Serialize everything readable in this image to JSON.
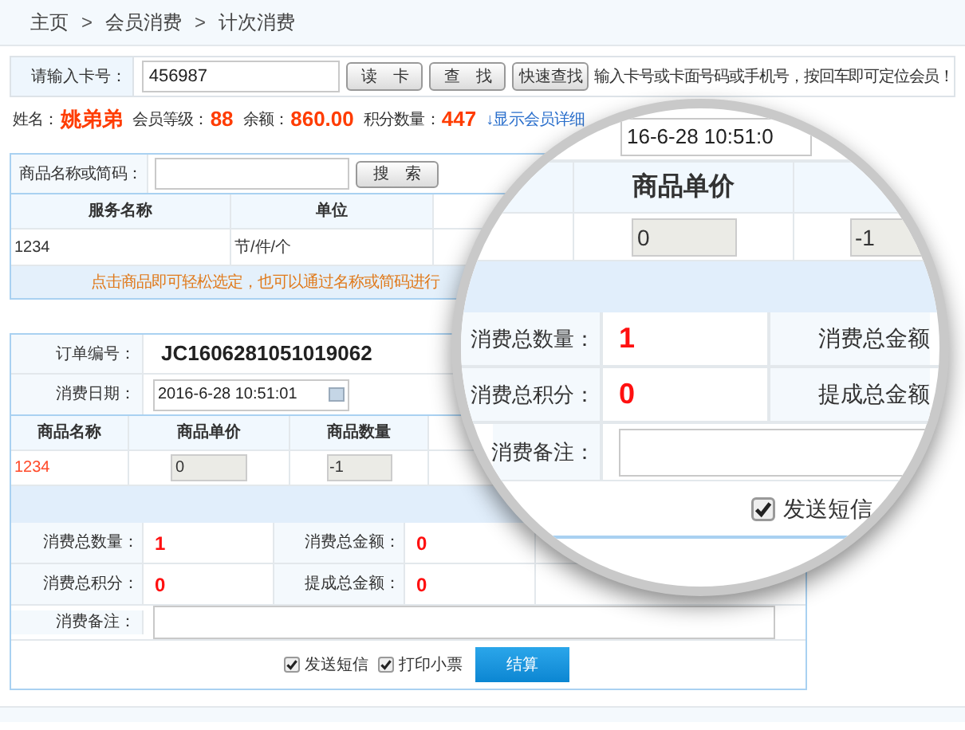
{
  "breadcrumb": {
    "items": [
      "主页",
      "会员消费",
      "计次消费"
    ],
    "separator": ">"
  },
  "card_lookup": {
    "label": "请输入卡号：",
    "value": "456987",
    "buttons": [
      "读　卡",
      "查　找",
      "快速查找"
    ],
    "hint": "输入卡号或卡面号码或手机号，按回车即可定位会员！"
  },
  "member": [
    {
      "label": "姓名：",
      "value": "姚弟弟"
    },
    {
      "label": "会员等级：",
      "value": "88"
    },
    {
      "label": "余额：",
      "value": "860.00"
    },
    {
      "label": "积分数量：",
      "value": "447"
    }
  ],
  "member_link": "↓显示会员详细",
  "product_search": {
    "label": "商品名称或简码：",
    "button": "搜　索",
    "columns": [
      "服务名称",
      "单位"
    ],
    "rows": [
      [
        "1234",
        "节/件/个"
      ]
    ],
    "tip": "点击商品即可轻松选定，也可以通过名称或简码进行"
  },
  "order": {
    "number_label": "订单编号：",
    "number": "JC1606281051019062",
    "date_label": "消费日期：",
    "date": "2016-6-28 10:51:01",
    "columns": [
      "商品名称",
      "商品单价",
      "商品数量"
    ],
    "items": [
      {
        "name": "1234",
        "price": "0",
        "quantity": "-1"
      }
    ],
    "totals": [
      {
        "label": "消费总数量：",
        "value": "1"
      },
      {
        "label": "消费总金额：",
        "value": "0"
      },
      {
        "label": "消费总积分：",
        "value": "0"
      },
      {
        "label": "提成总金额：",
        "value": "0"
      }
    ],
    "note_label": "消费备注：",
    "options": [
      {
        "label": "发送短信",
        "checked": true
      },
      {
        "label": "打印小票",
        "checked": true
      }
    ],
    "submit": "结算"
  },
  "magnifier": {
    "date": "16-6-28 10:51:0",
    "column": "商品单价",
    "price": "0",
    "quantity": "-1",
    "totals": [
      {
        "label": "消费总数量：",
        "value": "1"
      },
      {
        "label": "消费总金额"
      },
      {
        "label": "消费总积分：",
        "value": "0"
      },
      {
        "label": "提成总金额"
      }
    ],
    "note_label": "消费备注：",
    "option": {
      "label": "发送短信",
      "checked": true
    }
  }
}
